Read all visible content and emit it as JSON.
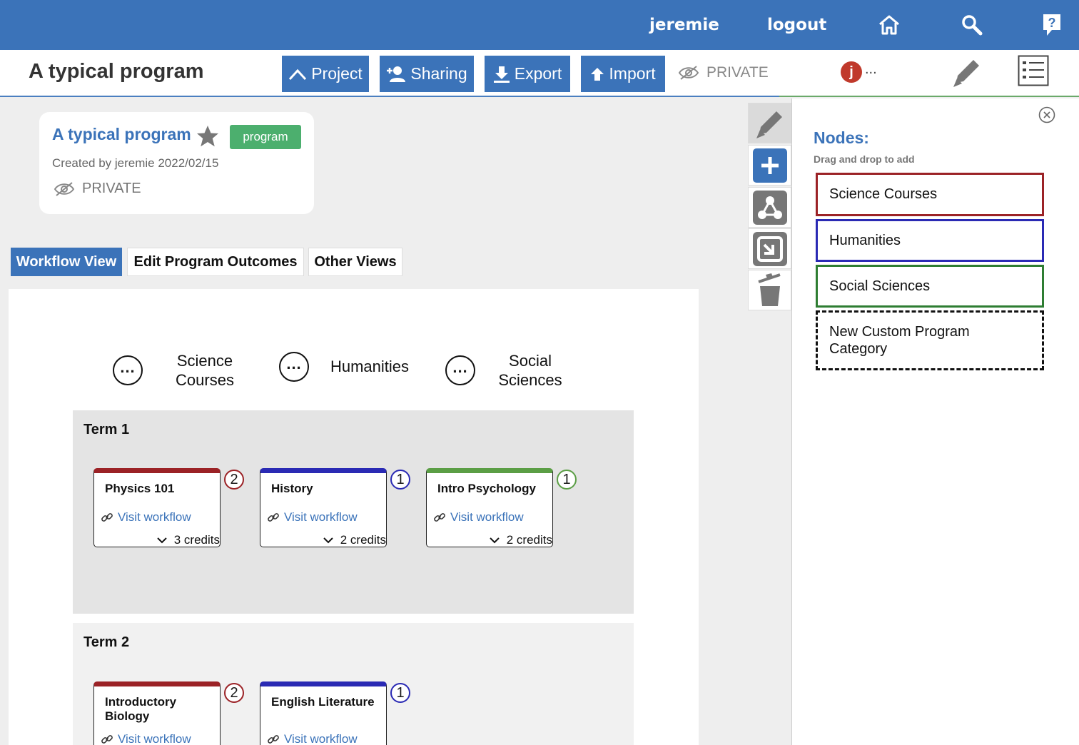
{
  "topbar": {
    "username": "jeremie",
    "logout": "logout",
    "icons": [
      "home-icon",
      "search-icon",
      "help-icon"
    ]
  },
  "header": {
    "title": "A typical program",
    "buttons": {
      "project": "Project",
      "sharing": "Sharing",
      "export": "Export",
      "import": "Import"
    },
    "visibility": "PRIVATE",
    "user_initial": "j",
    "user_more": "..."
  },
  "project_card": {
    "title": "A typical program",
    "type_badge": "program",
    "created": "Created by jeremie 2022/02/15",
    "visibility": "PRIVATE"
  },
  "view_tabs": [
    "Workflow View",
    "Edit Program Outcomes",
    "Other Views"
  ],
  "columns": [
    "Science Courses",
    "Humanities",
    "Social Sciences"
  ],
  "node_common": {
    "link": "Visit workflow"
  },
  "terms": [
    {
      "label": "Term 1",
      "nodes": [
        {
          "title": "Physics 101",
          "credits": "3 credits",
          "badge": "2",
          "category": "Science Courses"
        },
        {
          "title": "History",
          "credits": "2 credits",
          "badge": "1",
          "category": "Humanities"
        },
        {
          "title": "Intro Psychology",
          "credits": "2 credits",
          "badge": "1",
          "category": "Social Sciences"
        }
      ]
    },
    {
      "label": "Term 2",
      "nodes": [
        {
          "title": "Introductory Biology",
          "badge": "2",
          "category": "Science Courses"
        },
        {
          "title": "English Literature",
          "badge": "1",
          "category": "Humanities"
        }
      ]
    }
  ],
  "right_panel": {
    "title": "Nodes:",
    "subtitle": "Drag and drop to add",
    "nodes": [
      "Science Courses",
      "Humanities",
      "Social Sciences",
      "New Custom Program Category"
    ]
  },
  "colors": {
    "brand_blue": "#3b73b9",
    "science": "#9b2226",
    "humanities": "#2a2ab4",
    "social": "#5b9e45",
    "program_badge": "#4caf6e"
  }
}
